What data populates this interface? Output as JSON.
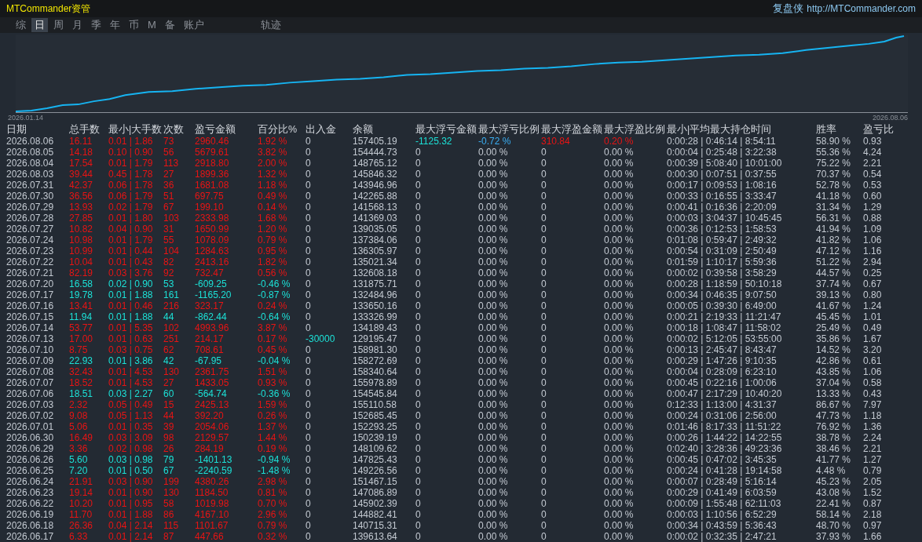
{
  "window": {
    "title": "MTCommander资管",
    "brand": "复盘侠",
    "url": "http://MTCommander.com"
  },
  "tabs": [
    {
      "label": "综",
      "selected": false
    },
    {
      "label": "日",
      "selected": true
    },
    {
      "label": "周",
      "selected": false
    },
    {
      "label": "月",
      "selected": false
    },
    {
      "label": "季",
      "selected": false
    },
    {
      "label": "年",
      "selected": false
    },
    {
      "label": "币",
      "selected": false
    },
    {
      "label": "M",
      "selected": false
    },
    {
      "label": "备",
      "selected": false
    },
    {
      "label": "账户",
      "selected": false
    }
  ],
  "track_tab": {
    "label": "轨迹",
    "selected": false
  },
  "chart": {
    "start_label": "2026.01.14",
    "end_label": "2026.08.06"
  },
  "table": {
    "columns": [
      "日期",
      "总手数",
      "最小|大手数",
      "次数",
      "盈亏金额",
      "百分比%",
      "出入金",
      "余额",
      "最大浮亏金额",
      "最大浮亏比例",
      "最大浮盈金额",
      "最大浮盈比例",
      "最小|平均最大持仓时间",
      "胜率",
      "盈亏比"
    ],
    "rows": [
      {
        "kind": "gain",
        "cells": [
          "2026.08.06",
          "16.11",
          "0.01 | 1.86",
          "73",
          "2960.46",
          "1.92 %",
          "0",
          "157405.19",
          {
            "text": "-1125.32",
            "kind": "loss"
          },
          {
            "text": "-0.72 %",
            "kind": "float"
          },
          {
            "text": "310.84",
            "kind": "gain"
          },
          {
            "text": "0.20 %",
            "kind": "gain"
          },
          "0:00:28 | 0:46:14 | 8:54:11",
          "58.90 %",
          "0.93"
        ]
      },
      {
        "kind": "gain",
        "cells": [
          "2026.08.05",
          "14.18",
          "0.10 | 0.90",
          "56",
          "5679.61",
          "3.82 %",
          "0",
          "154444.73",
          "0",
          "0.00 %",
          "0",
          "0.00 %",
          "0:00:04 | 0:25:48 | 3:22:38",
          "55.36 %",
          "4.24"
        ]
      },
      {
        "kind": "gain",
        "cells": [
          "2026.08.04",
          "17.54",
          "0.01 | 1.79",
          "113",
          "2918.80",
          "2.00 %",
          "0",
          "148765.12",
          "0",
          "0.00 %",
          "0",
          "0.00 %",
          "0:00:39 | 5:08:40 | 10:01:00",
          "75.22 %",
          "2.21"
        ]
      },
      {
        "kind": "gain",
        "cells": [
          "2026.08.03",
          "39.44",
          "0.45 | 1.78",
          "27",
          "1899.36",
          "1.32 %",
          "0",
          "145846.32",
          "0",
          "0.00 %",
          "0",
          "0.00 %",
          "0:00:30 | 0:07:51 | 0:37:55",
          "70.37 %",
          "0.54"
        ]
      },
      {
        "kind": "gain",
        "cells": [
          "2026.07.31",
          "42.37",
          "0.06 | 1.78",
          "36",
          "1681.08",
          "1.18 %",
          "0",
          "143946.96",
          "0",
          "0.00 %",
          "0",
          "0.00 %",
          "0:00:17 | 0:09:53 | 1:08:16",
          "52.78 %",
          "0.53"
        ]
      },
      {
        "kind": "gain",
        "cells": [
          "2026.07.30",
          "36.56",
          "0.06 | 1.79",
          "51",
          "697.75",
          "0.49 %",
          "0",
          "142265.88",
          "0",
          "0.00 %",
          "0",
          "0.00 %",
          "0:00:33 | 0:16:55 | 3:33:47",
          "41.18 %",
          "0.60"
        ]
      },
      {
        "kind": "gain",
        "cells": [
          "2026.07.29",
          "13.93",
          "0.02 | 1.79",
          "67",
          "199.10",
          "0.14 %",
          "0",
          "141568.13",
          "0",
          "0.00 %",
          "0",
          "0.00 %",
          "0:00:41 | 0:16:36 | 2:20:09",
          "31.34 %",
          "1.29"
        ]
      },
      {
        "kind": "gain",
        "cells": [
          "2026.07.28",
          "27.85",
          "0.01 | 1.80",
          "103",
          "2333.98",
          "1.68 %",
          "0",
          "141369.03",
          "0",
          "0.00 %",
          "0",
          "0.00 %",
          "0:00:03 | 3:04:37 | 10:45:45",
          "56.31 %",
          "0.88"
        ]
      },
      {
        "kind": "gain",
        "cells": [
          "2026.07.27",
          "10.82",
          "0.04 | 0.90",
          "31",
          "1650.99",
          "1.20 %",
          "0",
          "139035.05",
          "0",
          "0.00 %",
          "0",
          "0.00 %",
          "0:00:36 | 0:12:53 | 1:58:53",
          "41.94 %",
          "1.09"
        ]
      },
      {
        "kind": "gain",
        "cells": [
          "2026.07.24",
          "10.98",
          "0.01 | 1.79",
          "55",
          "1078.09",
          "0.79 %",
          "0",
          "137384.06",
          "0",
          "0.00 %",
          "0",
          "0.00 %",
          "0:01:08 | 0:59:47 | 2:49:32",
          "41.82 %",
          "1.06"
        ]
      },
      {
        "kind": "gain",
        "cells": [
          "2026.07.23",
          "10.99",
          "0.01 | 0.44",
          "104",
          "1284.63",
          "0.95 %",
          "0",
          "136305.97",
          "0",
          "0.00 %",
          "0",
          "0.00 %",
          "0:00:54 | 0:31:09 | 2:50:49",
          "47.12 %",
          "1.16"
        ]
      },
      {
        "kind": "gain",
        "cells": [
          "2026.07.22",
          "10.04",
          "0.01 | 0.43",
          "82",
          "2413.16",
          "1.82 %",
          "0",
          "135021.34",
          "0",
          "0.00 %",
          "0",
          "0.00 %",
          "0:01:59 | 1:10:17 | 5:59:36",
          "51.22 %",
          "2.94"
        ]
      },
      {
        "kind": "gain",
        "cells": [
          "2026.07.21",
          "82.19",
          "0.03 | 3.76",
          "92",
          "732.47",
          "0.56 %",
          "0",
          "132608.18",
          "0",
          "0.00 %",
          "0",
          "0.00 %",
          "0:00:02 | 0:39:58 | 3:58:29",
          "44.57 %",
          "0.25"
        ]
      },
      {
        "kind": "loss",
        "cells": [
          "2026.07.20",
          "16.58",
          "0.02 | 0.90",
          "53",
          "-609.25",
          "-0.46 %",
          "0",
          "131875.71",
          "0",
          "0.00 %",
          "0",
          "0.00 %",
          "0:00:28 | 1:18:59 | 50:10:18",
          "37.74 %",
          "0.67"
        ]
      },
      {
        "kind": "loss",
        "cells": [
          "2026.07.17",
          "19.78",
          "0.01 | 1.88",
          "161",
          "-1165.20",
          "-0.87 %",
          "0",
          "132484.96",
          "0",
          "0.00 %",
          "0",
          "0.00 %",
          "0:00:34 | 0:46:35 | 9:07:50",
          "39.13 %",
          "0.80"
        ]
      },
      {
        "kind": "gain",
        "cells": [
          "2026.07.16",
          "13.41",
          "0.01 | 0.46",
          "216",
          "323.17",
          "0.24 %",
          "0",
          "133650.16",
          "0",
          "0.00 %",
          "0",
          "0.00 %",
          "0:00:05 | 0:39:30 | 6:49:00",
          "41.67 %",
          "1.24"
        ]
      },
      {
        "kind": "loss",
        "cells": [
          "2026.07.15",
          "11.94",
          "0.01 | 1.88",
          "44",
          "-862.44",
          "-0.64 %",
          "0",
          "133326.99",
          "0",
          "0.00 %",
          "0",
          "0.00 %",
          "0:00:21 | 2:19:33 | 11:21:47",
          "45.45 %",
          "1.01"
        ]
      },
      {
        "kind": "gain",
        "cells": [
          "2026.07.14",
          "53.77",
          "0.01 | 5.35",
          "102",
          "4993.96",
          "3.87 %",
          "0",
          "134189.43",
          "0",
          "0.00 %",
          "0",
          "0.00 %",
          "0:00:18 | 1:08:47 | 11:58:02",
          "25.49 %",
          "0.49"
        ]
      },
      {
        "kind": "gain",
        "cells": [
          "2026.07.13",
          "17.00",
          "0.01 | 0.63",
          "251",
          "214.17",
          "0.17 %",
          {
            "text": "-30000",
            "kind": "loss"
          },
          "129195.47",
          "0",
          "0.00 %",
          "0",
          "0.00 %",
          "0:00:02 | 5:12:05 | 53:55:00",
          "35.86 %",
          "1.67"
        ]
      },
      {
        "kind": "gain",
        "cells": [
          "2026.07.10",
          "8.75",
          "0.03 | 0.75",
          "62",
          "708.61",
          "0.45 %",
          "0",
          "158981.30",
          "0",
          "0.00 %",
          "0",
          "0.00 %",
          "0:00:13 | 2:45:47 | 8:43:47",
          "14.52 %",
          "3.20"
        ]
      },
      {
        "kind": "loss",
        "cells": [
          "2026.07.09",
          "22.93",
          "0.01 | 3.86",
          "42",
          "-67.95",
          "-0.04 %",
          "0",
          "158272.69",
          "0",
          "0.00 %",
          "0",
          "0.00 %",
          "0:00:29 | 1:47:26 | 9:10:35",
          "42.86 %",
          "0.61"
        ]
      },
      {
        "kind": "gain",
        "cells": [
          "2026.07.08",
          "32.43",
          "0.01 | 4.53",
          "130",
          "2361.75",
          "1.51 %",
          "0",
          "158340.64",
          "0",
          "0.00 %",
          "0",
          "0.00 %",
          "0:00:04 | 0:28:09 | 6:23:10",
          "43.85 %",
          "1.06"
        ]
      },
      {
        "kind": "gain",
        "cells": [
          "2026.07.07",
          "18.52",
          "0.01 | 4.53",
          "27",
          "1433.05",
          "0.93 %",
          "0",
          "155978.89",
          "0",
          "0.00 %",
          "0",
          "0.00 %",
          "0:00:45 | 0:22:16 | 1:00:06",
          "37.04 %",
          "0.58"
        ]
      },
      {
        "kind": "loss",
        "cells": [
          "2026.07.06",
          "18.51",
          "0.03 | 2.27",
          "60",
          "-564.74",
          "-0.36 %",
          "0",
          "154545.84",
          "0",
          "0.00 %",
          "0",
          "0.00 %",
          "0:00:47 | 2:17:29 | 10:40:20",
          "13.33 %",
          "0.43"
        ]
      },
      {
        "kind": "gain",
        "cells": [
          "2026.07.03",
          "2.32",
          "0.05 | 0.49",
          "15",
          "2425.13",
          "1.59 %",
          "0",
          "155110.58",
          "0",
          "0.00 %",
          "0",
          "0.00 %",
          "0:12:33 | 1:13:00 | 4:31:37",
          "86.67 %",
          "7.97"
        ]
      },
      {
        "kind": "gain",
        "cells": [
          "2026.07.02",
          "9.08",
          "0.05 | 1.13",
          "44",
          "392.20",
          "0.26 %",
          "0",
          "152685.45",
          "0",
          "0.00 %",
          "0",
          "0.00 %",
          "0:00:24 | 0:31:06 | 2:56:00",
          "47.73 %",
          "1.18"
        ]
      },
      {
        "kind": "gain",
        "cells": [
          "2026.07.01",
          "5.06",
          "0.01 | 0.35",
          "39",
          "2054.06",
          "1.37 %",
          "0",
          "152293.25",
          "0",
          "0.00 %",
          "0",
          "0.00 %",
          "0:01:46 | 8:17:33 | 11:51:22",
          "76.92 %",
          "1.36"
        ]
      },
      {
        "kind": "gain",
        "cells": [
          "2026.06.30",
          "16.49",
          "0.03 | 3.09",
          "98",
          "2129.57",
          "1.44 %",
          "0",
          "150239.19",
          "0",
          "0.00 %",
          "0",
          "0.00 %",
          "0:00:26 | 1:44:22 | 14:22:55",
          "38.78 %",
          "2.24"
        ]
      },
      {
        "kind": "gain",
        "cells": [
          "2026.06.29",
          "3.36",
          "0.02 | 0.98",
          "26",
          "284.19",
          "0.19 %",
          "0",
          "148109.62",
          "0",
          "0.00 %",
          "0",
          "0.00 %",
          "0:02:40 | 3:28:36 | 49:23:36",
          "38.46 %",
          "2.21"
        ]
      },
      {
        "kind": "loss",
        "cells": [
          "2026.06.26",
          "5.60",
          "0.03 | 0.98",
          "79",
          "-1401.13",
          "-0.94 %",
          "0",
          "147825.43",
          "0",
          "0.00 %",
          "0",
          "0.00 %",
          "0:00:45 | 0:47:02 | 3:45:35",
          "41.77 %",
          "1.27"
        ]
      },
      {
        "kind": "loss",
        "cells": [
          "2026.06.25",
          "7.20",
          "0.01 | 0.50",
          "67",
          "-2240.59",
          "-1.48 %",
          "0",
          "149226.56",
          "0",
          "0.00 %",
          "0",
          "0.00 %",
          "0:00:24 | 0:41:28 | 19:14:58",
          "4.48 %",
          "0.79"
        ]
      },
      {
        "kind": "gain",
        "cells": [
          "2026.06.24",
          "21.91",
          "0.03 | 0.90",
          "199",
          "4380.26",
          "2.98 %",
          "0",
          "151467.15",
          "0",
          "0.00 %",
          "0",
          "0.00 %",
          "0:00:07 | 0:28:49 | 5:16:14",
          "45.23 %",
          "2.05"
        ]
      },
      {
        "kind": "gain",
        "cells": [
          "2026.06.23",
          "19.14",
          "0.01 | 0.90",
          "130",
          "1184.50",
          "0.81 %",
          "0",
          "147086.89",
          "0",
          "0.00 %",
          "0",
          "0.00 %",
          "0:00:29 | 0:41:49 | 6:03:59",
          "43.08 %",
          "1.52"
        ]
      },
      {
        "kind": "gain",
        "cells": [
          "2026.06.22",
          "10.20",
          "0.01 | 0.95",
          "58",
          "1019.98",
          "0.70 %",
          "0",
          "145902.39",
          "0",
          "0.00 %",
          "0",
          "0.00 %",
          "0:00:09 | 1:55:48 | 62:11:03",
          "22.41 %",
          "0.87"
        ]
      },
      {
        "kind": "gain",
        "cells": [
          "2026.06.19",
          "11.70",
          "0.01 | 1.88",
          "86",
          "4167.10",
          "2.96 %",
          "0",
          "144882.41",
          "0",
          "0.00 %",
          "0",
          "0.00 %",
          "0:00:03 | 1:10:56 | 6:52:29",
          "58.14 %",
          "2.18"
        ]
      },
      {
        "kind": "gain",
        "cells": [
          "2026.06.18",
          "26.36",
          "0.04 | 2.14",
          "115",
          "1101.67",
          "0.79 %",
          "0",
          "140715.31",
          "0",
          "0.00 %",
          "0",
          "0.00 %",
          "0:00:34 | 0:43:59 | 5:36:43",
          "48.70 %",
          "0.97"
        ]
      },
      {
        "kind": "gain",
        "cells": [
          "2026.06.17",
          "6.33",
          "0.01 | 2.14",
          "87",
          "447.66",
          "0.32 %",
          "0",
          "139613.64",
          "0",
          "0.00 %",
          "0",
          "0.00 %",
          "0:00:02 | 0:32:35 | 2:47:21",
          "37.93 %",
          "1.66"
        ]
      }
    ]
  }
}
